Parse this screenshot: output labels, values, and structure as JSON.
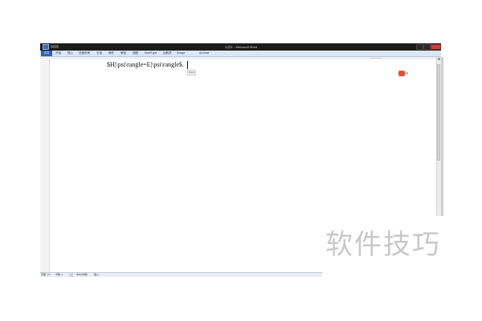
{
  "window": {
    "title": "公式1 - Microsoft Word"
  },
  "ribbon": {
    "tabs": [
      {
        "label": "文件"
      },
      {
        "label": "开始"
      },
      {
        "label": "插入"
      },
      {
        "label": "页面布局"
      },
      {
        "label": "引用"
      },
      {
        "label": "邮件"
      },
      {
        "label": "审阅"
      },
      {
        "label": "视图"
      },
      {
        "label": "MathType"
      },
      {
        "label": "加载项"
      },
      {
        "label": "SnagIt"
      },
      {
        "label": "Acrobat"
      }
    ]
  },
  "document": {
    "formula_text": "$H|\\psi\\rangle=E|\\psi\\rangle$.",
    "paste_options_label": "(Ctrl)"
  },
  "ime": {
    "label": "中"
  },
  "statusbar": {
    "items": [
      {
        "label": "页面: 1/1"
      },
      {
        "label": "字数: 1"
      },
      {
        "label": "中文(中国)"
      },
      {
        "label": "插入"
      }
    ]
  },
  "watermark": {
    "text": "软件技巧"
  },
  "colors": {
    "title_bar": "#1b1b1b",
    "file_tab": "#2e5fb0",
    "close_button": "#c9423c",
    "ime_badge": "#f04b2d",
    "watermark": "#c8c8c8"
  },
  "icons": [
    "word-app-icon",
    "quick-access-toolbar-icon",
    "minimize-icon",
    "maximize-icon",
    "close-icon",
    "paste-options-icon",
    "ime-icon",
    "scroll-up-arrow-icon",
    "proofing-icon"
  ]
}
